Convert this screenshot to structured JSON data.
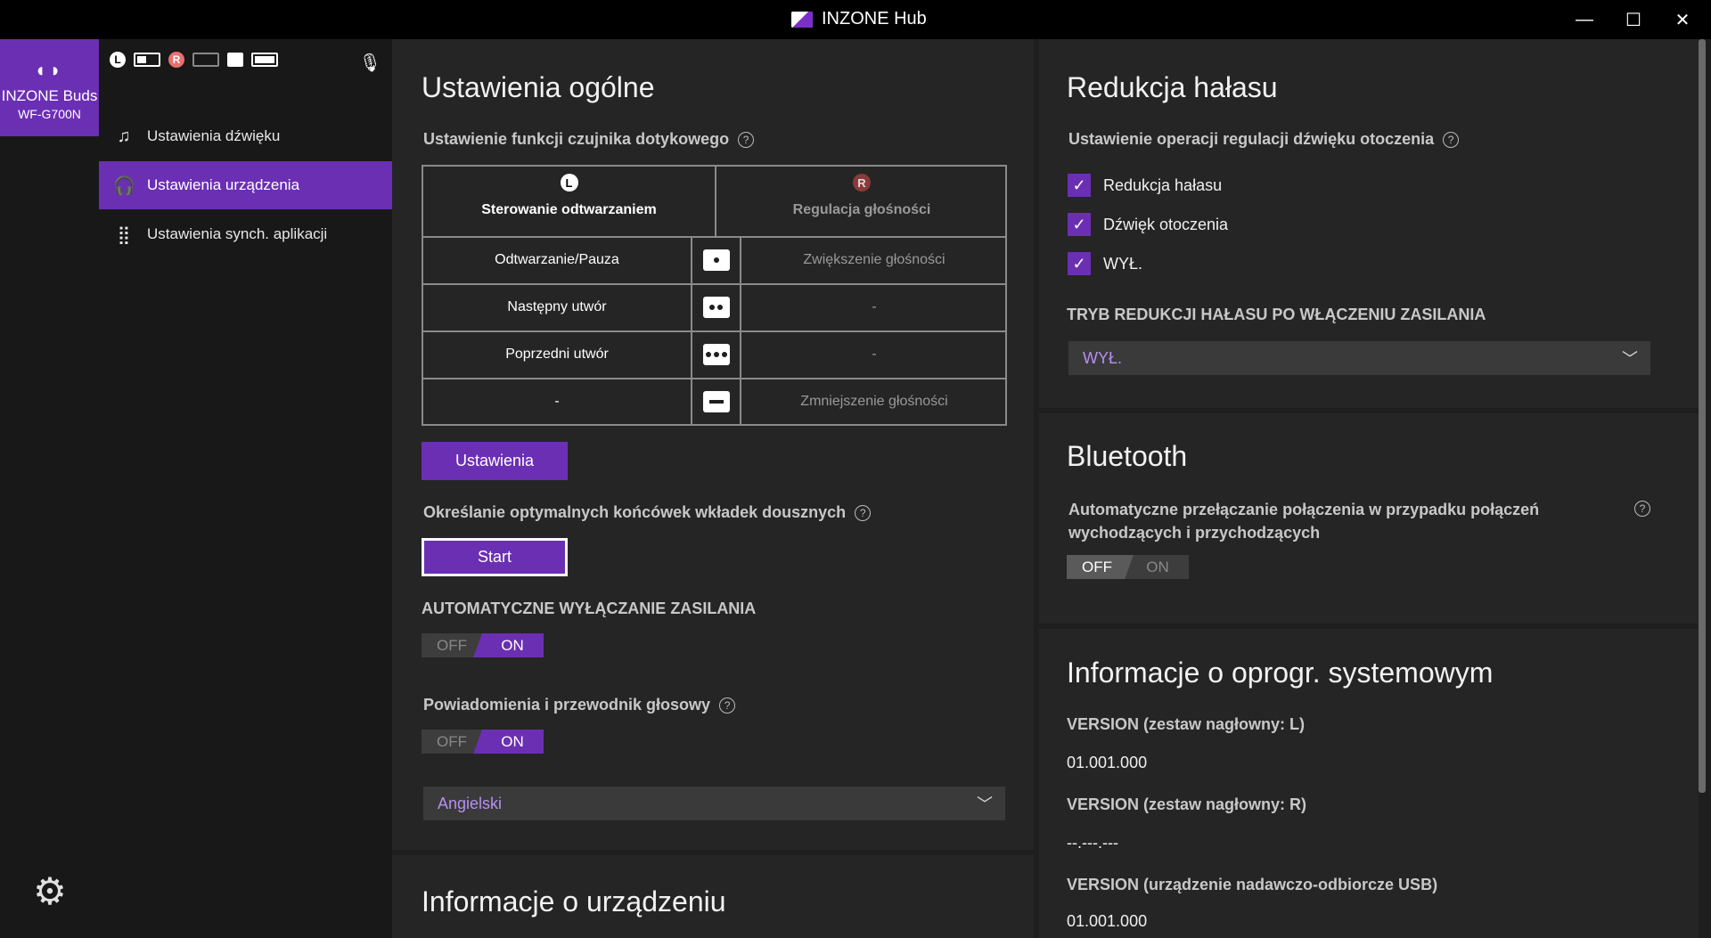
{
  "titlebar": {
    "title": "INZONE Hub",
    "minimize": "—",
    "maximize": "☐",
    "close": "✕"
  },
  "device": {
    "name": "INZONE Buds",
    "model": "WF-G700N"
  },
  "status": {
    "left": "L",
    "right": "R"
  },
  "nav": {
    "items": [
      {
        "label": "Ustawienia dźwięku"
      },
      {
        "label": "Ustawienia urządzenia"
      },
      {
        "label": "Ustawienia synch. aplikacji"
      }
    ]
  },
  "general": {
    "title": "Ustawienia ogólne",
    "touch_label": "Ustawienie funkcji czujnika dotykowego",
    "left_header": "Sterowanie odtwarzaniem",
    "right_header": "Regulacja głośności",
    "rows": [
      {
        "left": "Odtwarzanie/Pauza",
        "right": "Zwiększenie głośności"
      },
      {
        "left": "Następny utwór",
        "right": "-"
      },
      {
        "left": "Poprzedni utwór",
        "right": "-"
      },
      {
        "left": "-",
        "right": "Zmniejszenie głośności"
      }
    ],
    "settings_button": "Ustawienia",
    "eartips_label": "Określanie optymalnych końcówek wkładek dousznych",
    "start_button": "Start",
    "autopower_label": "AUTOMATYCZNE WYŁĄCZANIE ZASILANIA",
    "toggle_off": "OFF",
    "toggle_on": "ON",
    "voice_label": "Powiadomienia i przewodnik głosowy",
    "language": "Angielski",
    "device_info_title": "Informacje o urządzeniu"
  },
  "noise": {
    "title": "Redukcja hałasu",
    "ambient_label": "Ustawienie operacji regulacji dźwięku otoczenia",
    "options": [
      {
        "label": "Redukcja hałasu",
        "checked": true
      },
      {
        "label": "Dźwięk otoczenia",
        "checked": true
      },
      {
        "label": "WYŁ.",
        "checked": true
      }
    ],
    "poweron_label": "TRYB REDUKCJI HAŁASU PO WŁĄCZENIU ZASILANIA",
    "poweron_value": "WYŁ."
  },
  "bluetooth": {
    "title": "Bluetooth",
    "auto_switch_line1": "Automatyczne przełączanie połączenia w przypadku połączeń",
    "auto_switch_line2": "wychodzących i przychodzących",
    "toggle_off": "OFF",
    "toggle_on": "ON"
  },
  "firmware": {
    "title": "Informacje o oprogr. systemowym",
    "l_label": "VERSION (zestaw nagłowny: L)",
    "l_value": "01.001.000",
    "r_label": "VERSION (zestaw nagłowny: R)",
    "r_value": "--.---.---",
    "usb_label": "VERSION (urządzenie nadawczo-odbiorcze USB)",
    "usb_value": "01.001.000"
  },
  "colors": {
    "accent": "#6b2fb3",
    "bg": "#1e1e1e",
    "panel": "#252525"
  }
}
